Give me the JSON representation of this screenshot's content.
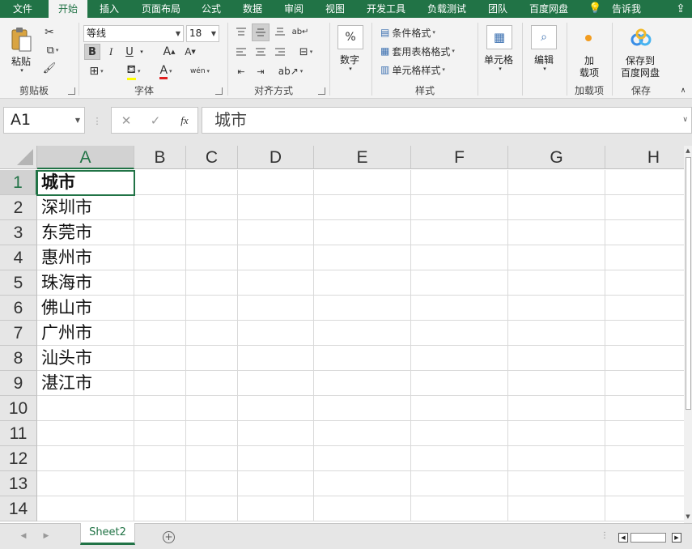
{
  "menu": {
    "tabs": [
      "文件",
      "开始",
      "插入",
      "页面布局",
      "公式",
      "数据",
      "审阅",
      "视图",
      "开发工具",
      "负载测试",
      "团队",
      "百度网盘",
      "告诉我"
    ],
    "active_tab": "开始"
  },
  "ribbon": {
    "clipboard": {
      "group_label": "剪贴板",
      "paste_label": "粘贴"
    },
    "font": {
      "group_label": "字体",
      "font_name": "等线",
      "font_size": "18",
      "bold": "B",
      "italic": "I",
      "underline": "U",
      "grow": "A",
      "shrink": "A",
      "phonetic": "wén"
    },
    "alignment": {
      "group_label": "对齐方式"
    },
    "number": {
      "label": "数字",
      "symbol": "%"
    },
    "styles": {
      "group_label": "样式",
      "conditional_format": "条件格式",
      "format_as_table": "套用表格格式",
      "cell_styles": "单元格样式"
    },
    "cells": {
      "label": "单元格"
    },
    "editing": {
      "label": "编辑"
    },
    "addins": {
      "button_label_1": "加",
      "button_label_2": "载项",
      "group_label": "加载项"
    },
    "save": {
      "button_label_1": "保存到",
      "button_label_2": "百度网盘",
      "group_label": "保存"
    }
  },
  "formula_bar": {
    "name_box": "A1",
    "fx": "fx",
    "value": "城市"
  },
  "sheet": {
    "columns": [
      "A",
      "B",
      "C",
      "D",
      "E",
      "F",
      "G",
      "H"
    ],
    "rows": [
      "1",
      "2",
      "3",
      "4",
      "5",
      "6",
      "7",
      "8",
      "9",
      "10",
      "11",
      "12",
      "13",
      "14"
    ],
    "cells_A": [
      "城市",
      "深圳市",
      "东莞市",
      "惠州市",
      "珠海市",
      "佛山市",
      "广州市",
      "汕头市",
      "湛江市",
      "",
      "",
      "",
      "",
      ""
    ],
    "selected_cell": "A1"
  },
  "sheet_tabs": {
    "active": "Sheet2"
  },
  "colors": {
    "accent": "#217346",
    "ribbon_bg": "#f3f3f3",
    "header_bg": "#e6e6e6"
  }
}
